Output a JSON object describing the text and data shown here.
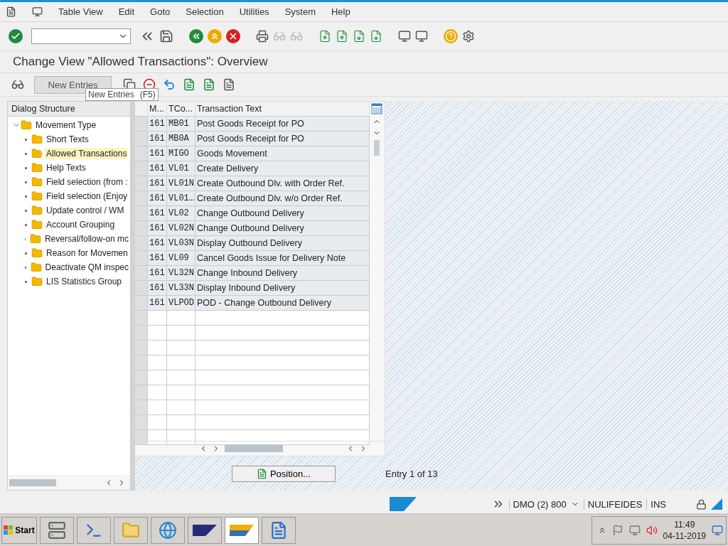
{
  "menu": [
    "Table View",
    "Edit",
    "Goto",
    "Selection",
    "Utilities",
    "System",
    "Help"
  ],
  "title": "Change View \"Allowed Transactions\": Overview",
  "new_entries_button": "New Entries",
  "tooltip": {
    "label": "New Entries",
    "shortcut": "(F5)"
  },
  "dialog_structure": {
    "title": "Dialog Structure",
    "tree": [
      {
        "label": "Movement Type",
        "expanded": true,
        "selected": false,
        "children": [
          {
            "label": "Short Texts",
            "selected": false
          },
          {
            "label": "Allowed Transactions",
            "selected": true
          },
          {
            "label": "Help Texts",
            "selected": false
          },
          {
            "label": "Field selection (from :",
            "selected": false
          },
          {
            "label": "Field selection (Enjoy",
            "selected": false
          },
          {
            "label": "Update control / WM",
            "selected": false
          },
          {
            "label": "Account Grouping",
            "selected": false
          },
          {
            "label": "Reversal/follow-on mc",
            "selected": false
          },
          {
            "label": "Reason for Movemen",
            "selected": false
          },
          {
            "label": "Deactivate QM inspec",
            "selected": false
          },
          {
            "label": "LIS Statistics Group",
            "selected": false
          }
        ]
      }
    ]
  },
  "table": {
    "columns": [
      "M...",
      "TCo...",
      "Transaction Text"
    ],
    "rows": [
      [
        "161",
        "MB01",
        "Post Goods Receipt for PO"
      ],
      [
        "161",
        "MB0A",
        "Post Goods Receipt for PO"
      ],
      [
        "161",
        "MIGO",
        "Goods Movement"
      ],
      [
        "161",
        "VL01",
        "Create Delivery"
      ],
      [
        "161",
        "VL01N",
        "Create Outbound Dlv. with Order Ref."
      ],
      [
        "161",
        "VL01…",
        "Create Outbound Dlv. w/o Order Ref."
      ],
      [
        "161",
        "VL02",
        "Change Outbound Delivery"
      ],
      [
        "161",
        "VL02N",
        "Change Outbound Delivery"
      ],
      [
        "161",
        "VL03N",
        "Display Outbound Delivery"
      ],
      [
        "161",
        "VL09",
        "Cancel Goods Issue for Delivery Note"
      ],
      [
        "161",
        "VL32N",
        "Change Inbound Delivery"
      ],
      [
        "161",
        "VL33N",
        "Display Inbound Delivery"
      ],
      [
        "161",
        "VLPOD",
        "POD - Change Outbound Delivery"
      ]
    ]
  },
  "position_button": "Position...",
  "entry_info": "Entry 1 of 13",
  "status_bar": {
    "system": "DMO (2) 800",
    "user": "NULIFEIDES",
    "mode": "INS"
  },
  "taskbar": {
    "start": "Start",
    "time": "11:49",
    "date": "04-11-2019"
  }
}
